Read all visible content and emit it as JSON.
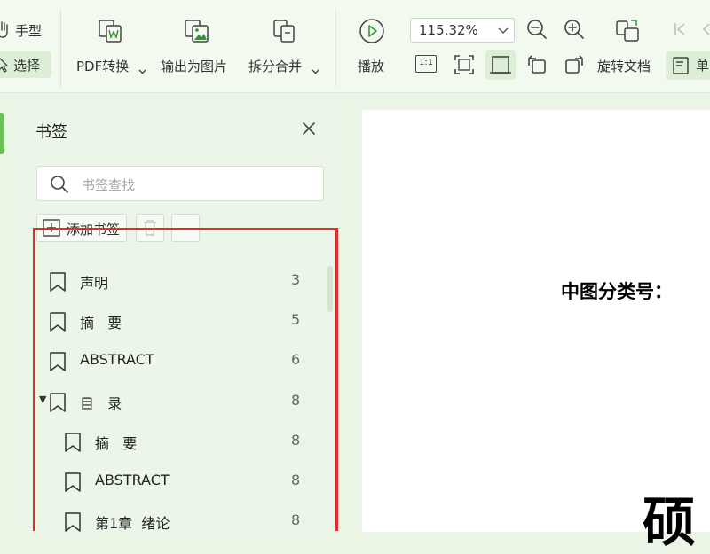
{
  "toolbar": {
    "hand_label": "手型",
    "select_label": "选择",
    "pdf_convert_label": "PDF转换",
    "export_image_label": "输出为图片",
    "split_merge_label": "拆分合并",
    "play_label": "播放",
    "zoom_value": "115.32%",
    "rotate_doc_label": "旋转文档",
    "single_page_label": "单",
    "actual_size_label": "1:1"
  },
  "bookmark_panel": {
    "title": "书签",
    "search_placeholder": "书签查找",
    "add_label": "添加书签",
    "items": [
      {
        "label": "声明",
        "page": "3",
        "level": 0,
        "expanded": false
      },
      {
        "label": "摘   要",
        "page": "5",
        "level": 0,
        "expanded": false
      },
      {
        "label": "ABSTRACT",
        "page": "6",
        "level": 0,
        "expanded": false
      },
      {
        "label": "目   录",
        "page": "8",
        "level": 0,
        "expanded": true
      },
      {
        "label": "摘   要",
        "page": "8",
        "level": 1,
        "expanded": false
      },
      {
        "label": "ABSTRACT",
        "page": "8",
        "level": 1,
        "expanded": false
      },
      {
        "label": "第1章  绪论",
        "page": "8",
        "level": 1,
        "expanded": false
      }
    ]
  },
  "document": {
    "classification_label": "中图分类号：",
    "big_char": "硕"
  },
  "colors": {
    "accent": "#6cbf5b",
    "highlight_border": "#e02d2d",
    "panel_bg": "#ebf6e8"
  }
}
